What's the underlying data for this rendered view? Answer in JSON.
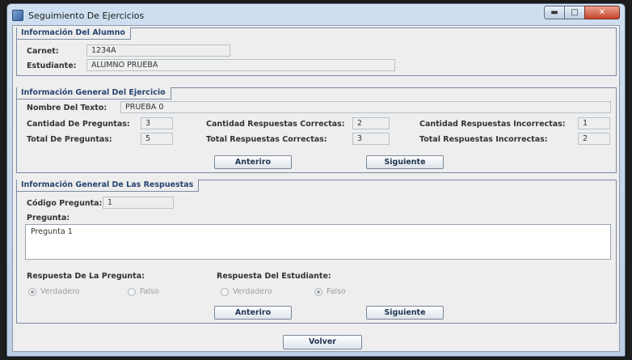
{
  "window": {
    "title": "Seguimiento De Ejercicios"
  },
  "alumno": {
    "tab": "Información Del Alumno",
    "carnet_label": "Carnet:",
    "carnet_value": "1234A",
    "estudiante_label": "Estudiante:",
    "estudiante_value": "ALUMNO PRUEBA"
  },
  "ejercicio": {
    "tab": "Información General Del Ejercicio",
    "nombre_label": "Nombre Del Texto:",
    "nombre_value": "PRUEBA 0",
    "cant_preg_label": "Cantidad De Preguntas:",
    "cant_preg_value": "3",
    "cant_corr_label": "Cantidad Respuestas Correctas:",
    "cant_corr_value": "2",
    "cant_inc_label": "Cantidad Respuestas Incorrectas:",
    "cant_inc_value": "1",
    "tot_preg_label": "Total De Preguntas:",
    "tot_preg_value": "5",
    "tot_corr_label": "Total Respuestas Correctas:",
    "tot_corr_value": "3",
    "tot_inc_label": "Total Respuestas Incorrectas:",
    "tot_inc_value": "2",
    "prev_button": "Anteriro",
    "next_button": "Siguiente"
  },
  "respuestas": {
    "tab": "Información General De Las Respuestas",
    "codigo_label": "Código Pregunta:",
    "codigo_value": "1",
    "pregunta_label": "Pregunta:",
    "pregunta_text": "Pregunta 1",
    "resp_preg_label": "Respuesta De La Pregunta:",
    "resp_est_label": "Respuesta Del Estudiante:",
    "verdadero": "Verdadero",
    "falso": "Falso",
    "prev_button": "Anteriro",
    "next_button": "Siguiente"
  },
  "volver_button": "Volver"
}
